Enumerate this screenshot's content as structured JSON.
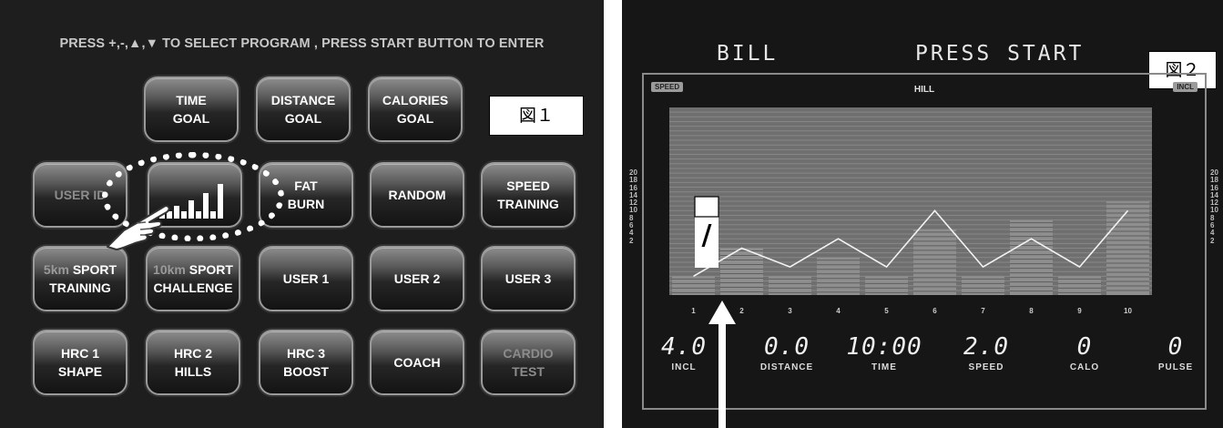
{
  "panel1": {
    "instruction": "PRESS +,-,▲,▼ TO SELECT PROGRAM , PRESS START BUTTON TO ENTER",
    "figure_label": "図１",
    "buttons": {
      "time_goal": {
        "line1": "TIME",
        "line2": "GOAL"
      },
      "distance_goal": {
        "line1": "DISTANCE",
        "line2": "GOAL"
      },
      "calories_goal": {
        "line1": "CALORIES",
        "line2": "GOAL"
      },
      "user_id": {
        "line1": "USER ID"
      },
      "fat_burn": {
        "line1": "FAT",
        "line2": "BURN"
      },
      "random": {
        "line1": "RANDOM"
      },
      "speed_training": {
        "line1": "SPEED",
        "line2": "TRAINING"
      },
      "sport_training": {
        "prefix": "5km",
        "line1": "SPORT",
        "line2": "TRAINING"
      },
      "sport_challenge": {
        "prefix": "10km",
        "line1": "SPORT",
        "line2": "CHALLENGE"
      },
      "user1": {
        "line1": "USER 1"
      },
      "user2": {
        "line1": "USER 2"
      },
      "user3": {
        "line1": "USER 3"
      },
      "hrc1": {
        "line1": "HRC 1",
        "line2": "SHAPE"
      },
      "hrc2": {
        "line1": "HRC 2",
        "line2": "HILLS"
      },
      "hrc3": {
        "line1": "HRC 3",
        "line2": "BOOST"
      },
      "coach": {
        "line1": "COACH"
      },
      "cardio_test": {
        "line1": "CARDIO",
        "line2": "TEST"
      }
    },
    "selected_icon": "hill-profile-icon"
  },
  "panel2": {
    "user_name": "BILL",
    "status": "PRESS START",
    "figure_label": "図２",
    "speed_tag": "SPEED",
    "incl_tag": "INCL",
    "program_name": "HILL",
    "scale_labels": [
      "20",
      "18",
      "16",
      "14",
      "12",
      "10",
      "8",
      "6",
      "4",
      "2"
    ],
    "segment_labels": [
      "1",
      "2",
      "3",
      "4",
      "5",
      "6",
      "7",
      "8",
      "9",
      "10"
    ],
    "readouts": {
      "incl": {
        "value": "4.0",
        "label": "INCL"
      },
      "distance": {
        "value": "0.0",
        "label": "DISTANCE"
      },
      "time": {
        "value": "10:00",
        "label": "TIME"
      },
      "speed": {
        "value": "2.0",
        "label": "SPEED"
      },
      "calo": {
        "value": "0",
        "label": "CALO"
      },
      "pulse": {
        "value": "0",
        "label": "PULSE"
      }
    },
    "callout_mark": "/"
  },
  "chart_data": {
    "type": "bar",
    "categories": [
      "1",
      "2",
      "3",
      "4",
      "5",
      "6",
      "7",
      "8",
      "9",
      "10"
    ],
    "series": [
      {
        "values": [
          2,
          5,
          2,
          4,
          2,
          7,
          2,
          8,
          2,
          10
        ]
      }
    ],
    "line_values": [
      2,
      5,
      3,
      6,
      3,
      9,
      3,
      6,
      3,
      9
    ],
    "ylim": [
      0,
      20
    ],
    "grid": true
  },
  "colors": {
    "panel1_bg": "#1e1e1e",
    "lcd_bg": "#161616",
    "lcd_bar": "#7a7a7a",
    "highlight": "#ffffff"
  }
}
